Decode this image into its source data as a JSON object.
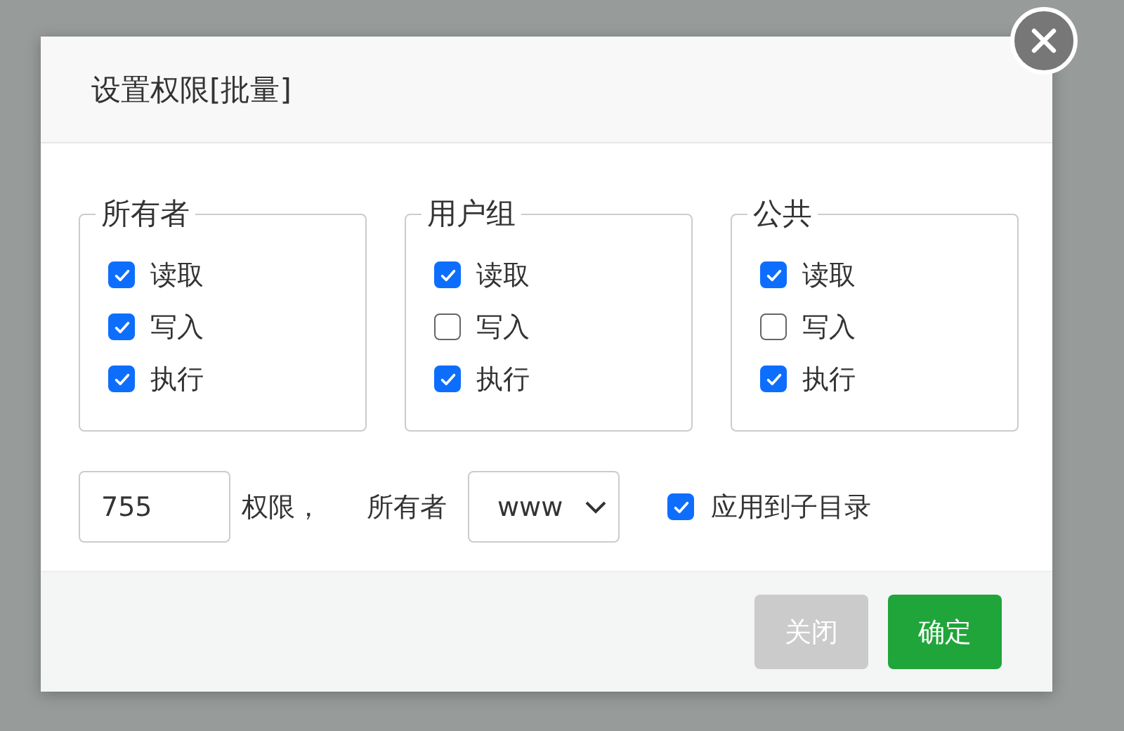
{
  "dialog": {
    "title": "设置权限[批量]",
    "groups": [
      {
        "legend": "所有者",
        "options": [
          {
            "label": "读取",
            "checked": true
          },
          {
            "label": "写入",
            "checked": true
          },
          {
            "label": "执行",
            "checked": true
          }
        ]
      },
      {
        "legend": "用户组",
        "options": [
          {
            "label": "读取",
            "checked": true
          },
          {
            "label": "写入",
            "checked": false
          },
          {
            "label": "执行",
            "checked": true
          }
        ]
      },
      {
        "legend": "公共",
        "options": [
          {
            "label": "读取",
            "checked": true
          },
          {
            "label": "写入",
            "checked": false
          },
          {
            "label": "执行",
            "checked": true
          }
        ]
      }
    ],
    "mode": {
      "value": "755"
    },
    "mode_label": "权限，",
    "owner_label": "所有者",
    "owner_select": {
      "value": "www"
    },
    "recursive": {
      "label": "应用到子目录",
      "checked": true
    },
    "buttons": [
      {
        "label": "关闭",
        "kind": "secondary"
      },
      {
        "label": "确定",
        "kind": "primary"
      }
    ]
  }
}
